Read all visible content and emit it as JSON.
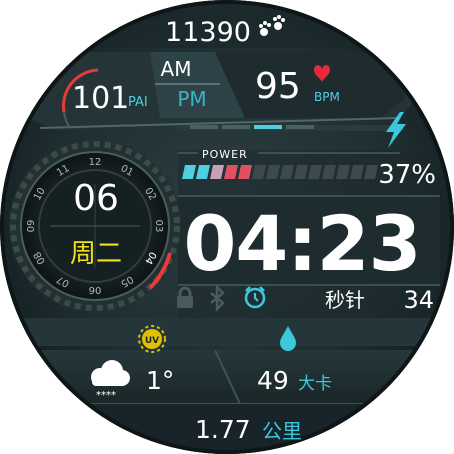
{
  "steps": {
    "value": "11390"
  },
  "ampm": {
    "am": "AM",
    "pm": "PM",
    "active": "AM"
  },
  "pai": {
    "value": "101",
    "unit": "PAI"
  },
  "heart": {
    "value": "95",
    "unit": "BPM"
  },
  "power": {
    "label": "POWER",
    "percent_text": "37%",
    "percent": 37
  },
  "date": {
    "day": "06",
    "weekday": "周二"
  },
  "dial": {
    "numbers": [
      "12",
      "01",
      "02",
      "03",
      "04",
      "05",
      "06",
      "07",
      "08",
      "09",
      "10",
      "11"
    ],
    "highlight": "04"
  },
  "time": {
    "value": "04:23"
  },
  "seconds": {
    "label": "秒针",
    "value": "34"
  },
  "uv": {
    "label": "UV"
  },
  "weather": {
    "temp": "1°",
    "stars": "****"
  },
  "calories": {
    "value": "49",
    "unit": "大卡"
  },
  "distance": {
    "value": "1.77",
    "unit": "公里"
  },
  "colors": {
    "accent": "#4fd0e0",
    "pai_red": "#e83a3a",
    "heart": "#e8283c",
    "weekday": "#f0e020",
    "battery_low": "#e05060",
    "teal_icon": "#3cc8dc"
  }
}
